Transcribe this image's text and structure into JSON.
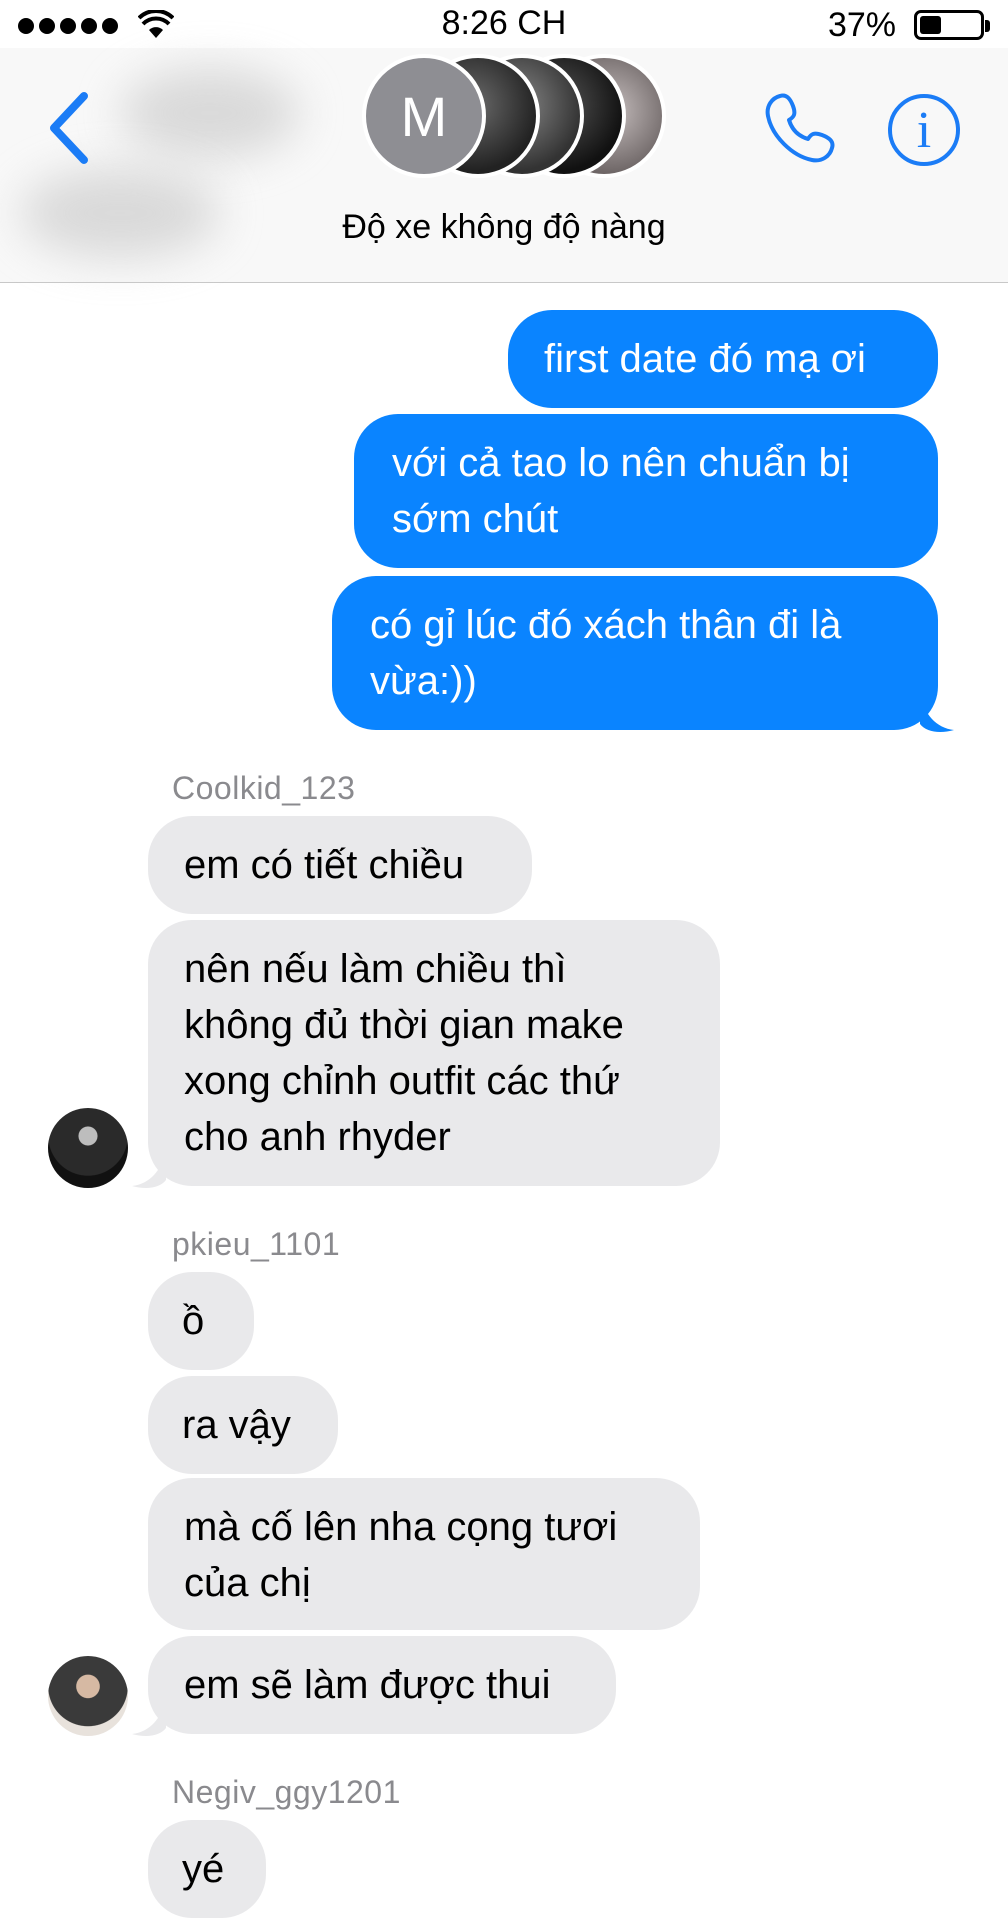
{
  "status_bar": {
    "time": "8:26 CH",
    "battery_percent": "37%",
    "battery_level": 0.37
  },
  "header": {
    "group_initial": "M",
    "group_name": "Độ xe không độ nàng"
  },
  "colors": {
    "accent": "#1b7cf6",
    "outgoing_bubble": "#0a84ff",
    "incoming_bubble": "#e9e9eb",
    "sender_name": "#8a8a8e"
  },
  "icons": {
    "back": "chevron-left-icon",
    "call": "phone-icon",
    "info": "info-icon"
  },
  "messages": {
    "out": [
      {
        "text": "first date đó mạ ơi"
      },
      {
        "text": "với cả tao lo nên chuẩn bị sớm chút"
      },
      {
        "text": "có gỉ lúc đó xách thân đi là vừa:))"
      }
    ],
    "group1": {
      "sender": "Coolkid_123",
      "items": [
        {
          "text": "em có tiết chiều"
        },
        {
          "text": "nên nếu làm chiều thì không đủ thời gian make xong chỉnh outfit các thứ cho anh rhyder"
        }
      ]
    },
    "group2": {
      "sender": "pkieu_1101",
      "items": [
        {
          "text": "ồ"
        },
        {
          "text": "ra vậy"
        },
        {
          "text": "mà cố lên nha cọng tươi của chị"
        },
        {
          "text": "em sẽ làm được thui"
        }
      ]
    },
    "group3": {
      "sender": "Negiv_ggy1201",
      "items": [
        {
          "text": "yé"
        }
      ]
    }
  }
}
